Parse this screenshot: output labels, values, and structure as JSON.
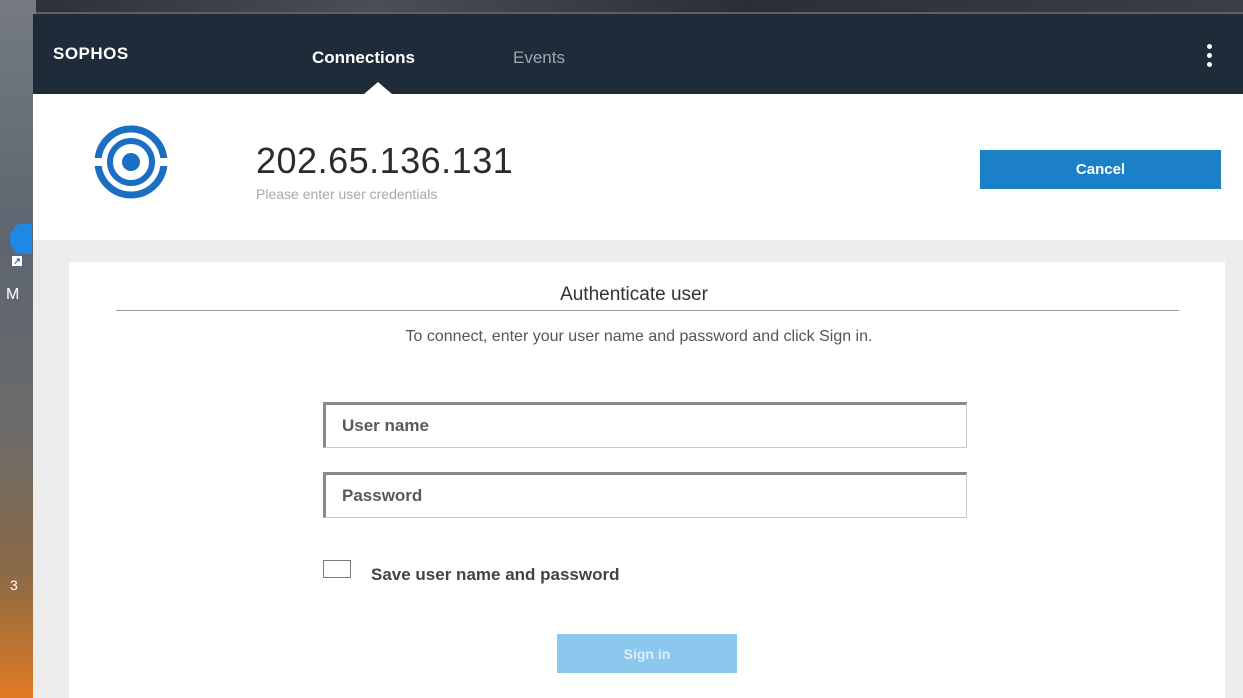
{
  "app": {
    "brand": "SOPHOS",
    "tabs": [
      {
        "label": "Connections",
        "active": true
      },
      {
        "label": "Events",
        "active": false
      }
    ],
    "menu_icon": "kebab-menu-icon"
  },
  "connection": {
    "address": "202.65.136.131",
    "status": "Please enter user credentials",
    "cancel_label": "Cancel",
    "logo_icon": "sophos-connect-target-icon"
  },
  "auth": {
    "title": "Authenticate user",
    "description": "To connect, enter your user name and password and click Sign in.",
    "username_placeholder": "User name",
    "password_placeholder": "Password",
    "save_label": "Save user name and password",
    "save_checked": false,
    "signin_label": "Sign in"
  },
  "desktop": {
    "icon_letter": "M",
    "edge_char": "3"
  },
  "colors": {
    "navbar": "#1e2c3a",
    "accent": "#1b80c7",
    "signin_disabled": "#8cc7ee"
  }
}
